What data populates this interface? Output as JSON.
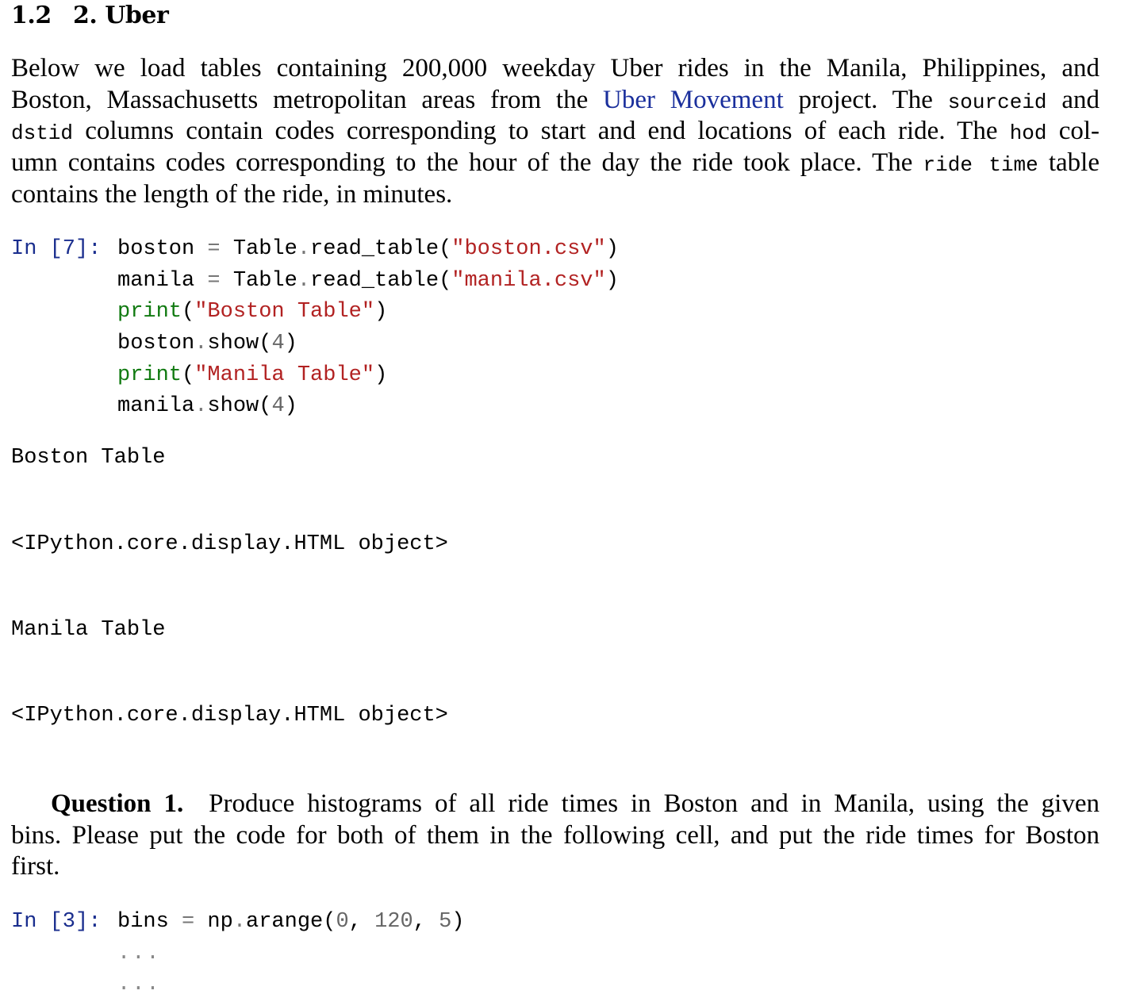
{
  "heading": {
    "number": "1.2",
    "title": "2. Uber"
  },
  "intro": {
    "lines": [
      [
        {
          "t": "text",
          "v": "Below we load tables containing 200,000 weekday Uber rides in the Manila, Philippines, and"
        }
      ],
      [
        {
          "t": "text",
          "v": "Boston, Massachusetts metropolitan areas from the "
        },
        {
          "t": "link",
          "v": "Uber Movement"
        },
        {
          "t": "text",
          "v": " project.  The "
        },
        {
          "t": "code",
          "v": "sourceid"
        },
        {
          "t": "text",
          "v": " and"
        }
      ],
      [
        {
          "t": "code",
          "v": "dstid"
        },
        {
          "t": "text",
          "v": " columns contain codes corresponding to start and end locations of each ride.  The "
        },
        {
          "t": "code",
          "v": "hod"
        },
        {
          "t": "text",
          "v": " col-"
        }
      ],
      [
        {
          "t": "text",
          "v": "umn contains codes corresponding to the hour of the day the ride took place. The "
        },
        {
          "t": "code",
          "v": "ride time"
        },
        {
          "t": "text",
          "v": " table"
        }
      ],
      [
        {
          "t": "text",
          "v": "contains the length of the ride, in minutes."
        }
      ]
    ]
  },
  "cell1": {
    "prompt": "In [7]:",
    "lines": [
      [
        {
          "c": "",
          "v": "boston "
        },
        {
          "c": "op",
          "v": "="
        },
        {
          "c": "",
          "v": " Table"
        },
        {
          "c": "op",
          "v": "."
        },
        {
          "c": "",
          "v": "read_table("
        },
        {
          "c": "str",
          "v": "\"boston.csv\""
        },
        {
          "c": "",
          "v": ")"
        }
      ],
      [
        {
          "c": "",
          "v": "manila "
        },
        {
          "c": "op",
          "v": "="
        },
        {
          "c": "",
          "v": " Table"
        },
        {
          "c": "op",
          "v": "."
        },
        {
          "c": "",
          "v": "read_table("
        },
        {
          "c": "str",
          "v": "\"manila.csv\""
        },
        {
          "c": "",
          "v": ")"
        }
      ],
      [
        {
          "c": "kw",
          "v": "print"
        },
        {
          "c": "",
          "v": "("
        },
        {
          "c": "str",
          "v": "\"Boston Table\""
        },
        {
          "c": "",
          "v": ")"
        }
      ],
      [
        {
          "c": "",
          "v": "boston"
        },
        {
          "c": "op",
          "v": "."
        },
        {
          "c": "",
          "v": "show("
        },
        {
          "c": "numlit",
          "v": "4"
        },
        {
          "c": "",
          "v": ")"
        }
      ],
      [
        {
          "c": "kw",
          "v": "print"
        },
        {
          "c": "",
          "v": "("
        },
        {
          "c": "str",
          "v": "\"Manila Table\""
        },
        {
          "c": "",
          "v": ")"
        }
      ],
      [
        {
          "c": "",
          "v": "manila"
        },
        {
          "c": "op",
          "v": "."
        },
        {
          "c": "",
          "v": "show("
        },
        {
          "c": "numlit",
          "v": "4"
        },
        {
          "c": "",
          "v": ")"
        }
      ]
    ]
  },
  "outputs": {
    "boston_label": "Boston Table",
    "boston_obj": "<IPython.core.display.HTML object>",
    "manila_label": "Manila Table",
    "manila_obj": "<IPython.core.display.HTML object>"
  },
  "question": {
    "label": "Question 1.",
    "lines": [
      "Produce histograms of all ride times in Boston and in Manila, using the given",
      "bins. Please put the code for both of them in the following cell, and put the ride times for Boston",
      "first."
    ]
  },
  "cell2": {
    "prompt": "In [3]:",
    "lines": [
      [
        {
          "c": "",
          "v": "bins "
        },
        {
          "c": "op",
          "v": "="
        },
        {
          "c": "",
          "v": " np"
        },
        {
          "c": "op",
          "v": "."
        },
        {
          "c": "",
          "v": "arange("
        },
        {
          "c": "numlit",
          "v": "0"
        },
        {
          "c": "",
          "v": ", "
        },
        {
          "c": "numlit",
          "v": "120"
        },
        {
          "c": "",
          "v": ", "
        },
        {
          "c": "numlit",
          "v": "5"
        },
        {
          "c": "",
          "v": ")"
        }
      ],
      [
        {
          "c": "ellipsis",
          "v": "..."
        }
      ],
      [
        {
          "c": "ellipsis",
          "v": "..."
        }
      ]
    ]
  },
  "colors": {
    "prompt": "#1a2e8e",
    "string": "#b22222",
    "keyword": "#117a11",
    "link": "#1a2f9c",
    "number": "#666666"
  }
}
